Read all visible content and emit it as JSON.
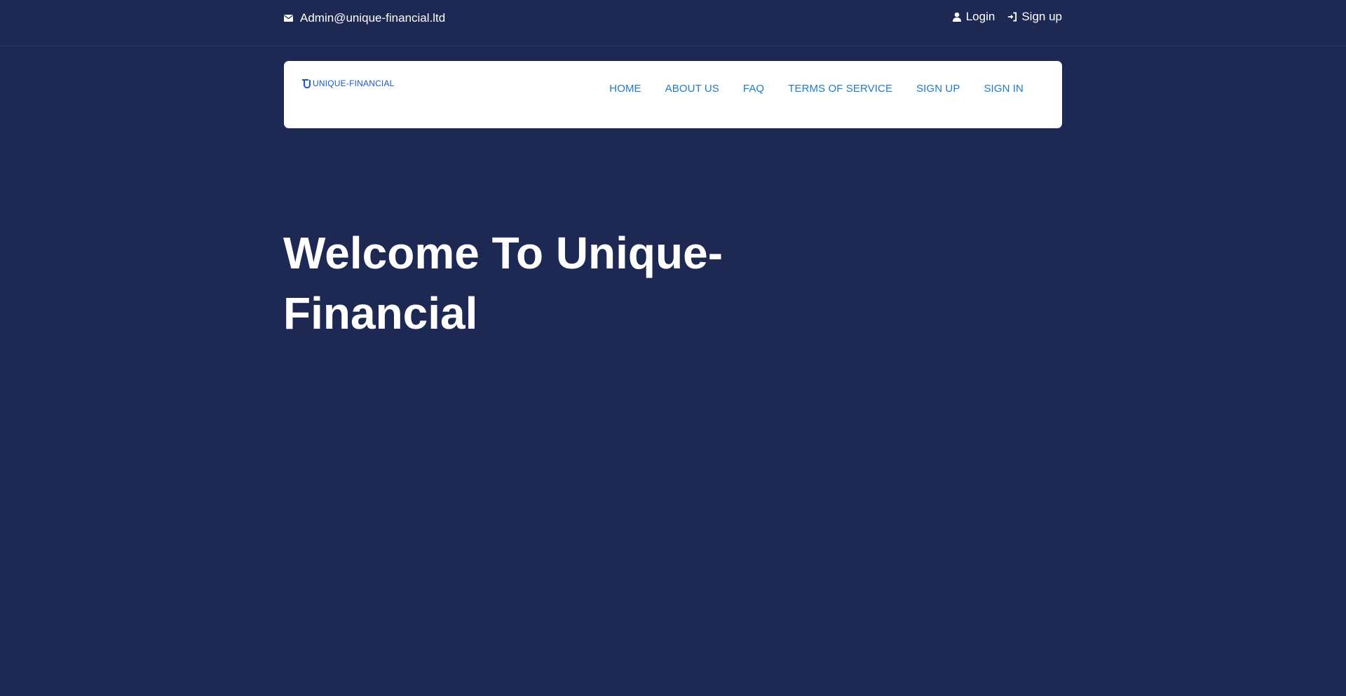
{
  "topbar": {
    "email": "Admin@unique-financial.ltd",
    "login_label": "Login",
    "signup_label": "Sign up"
  },
  "header": {
    "logo_text": "UNIQUE-FINANCIAL",
    "nav": [
      {
        "label": "HOME"
      },
      {
        "label": "ABOUT US"
      },
      {
        "label": "FAQ"
      },
      {
        "label": "TERMS OF SERVICE"
      },
      {
        "label": "SIGN UP"
      },
      {
        "label": "SIGN IN"
      }
    ]
  },
  "hero": {
    "title": "Welcome To Unique-Financial"
  },
  "colors": {
    "background": "#1e2953",
    "nav_link": "#1e7bc8",
    "logo": "#1a56d6"
  }
}
